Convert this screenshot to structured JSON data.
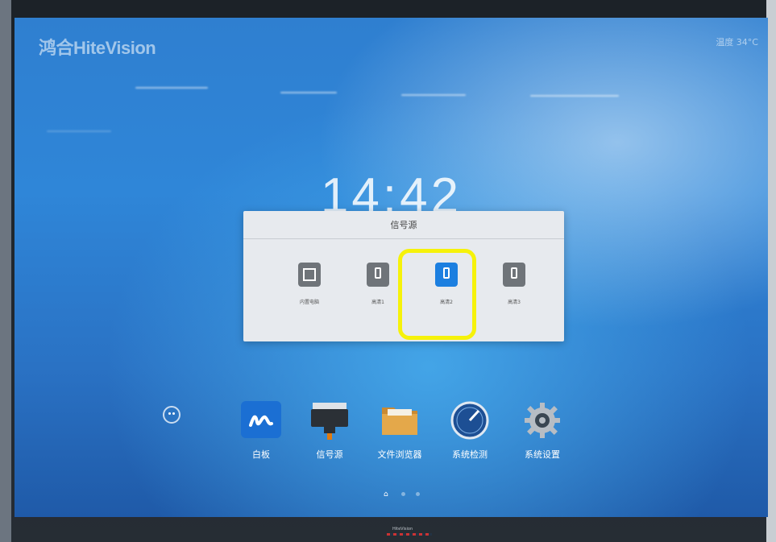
{
  "brand": "HiteVision",
  "brand_prefix": "鸿合",
  "temperature": "温度 34°C",
  "clock": "14:42",
  "signal_dialog": {
    "title": "信号源",
    "sources": [
      {
        "label": "内置电脑",
        "icon": "pc-icon",
        "active": false
      },
      {
        "label": "高清1",
        "icon": "hdmi-icon",
        "active": false
      },
      {
        "label": "高清2",
        "icon": "hdmi-icon",
        "active": true
      },
      {
        "label": "高清3",
        "icon": "hdmi-icon",
        "active": false
      }
    ]
  },
  "dock": {
    "apps": [
      {
        "label": "白板",
        "icon": "whiteboard-icon"
      },
      {
        "label": "信号源",
        "icon": "signal-source-icon"
      },
      {
        "label": "文件浏览器",
        "icon": "folder-icon"
      },
      {
        "label": "系统检测",
        "icon": "gauge-icon"
      },
      {
        "label": "系统设置",
        "icon": "gear-icon"
      }
    ]
  },
  "pager": {
    "home_glyph": "⌂"
  },
  "bezel_logo": "HiteVision",
  "colors": {
    "accent": "#1c7fe0",
    "highlight": "#f6f20a"
  }
}
